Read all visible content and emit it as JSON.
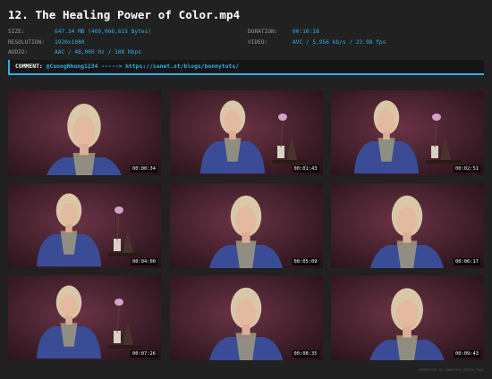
{
  "title": "12. The Healing Power of Color.mp4",
  "meta": {
    "size_label": "SIZE:",
    "size_value": "647.34 MB (469,066,615 Bytes)",
    "duration_label": "DURATION:",
    "duration_value": "00:10:18",
    "resolution_label": "RESOLUTION:",
    "resolution_value": "1920x1080",
    "video_label": "VIDEO:",
    "video_value": "AVC / 5,956 kb/s / 23.98 fps",
    "audio_label": "AUDIO:",
    "audio_value": "AAC / 48,000 Hz / 108 Kbps"
  },
  "comment": {
    "label": "COMMENT:",
    "text": "@CuongNhung1234 -----> https://sanet.st/blogs/bonnytuts/"
  },
  "thumbnails": [
    {
      "timestamp": "00:00:34"
    },
    {
      "timestamp": "00:01:43"
    },
    {
      "timestamp": "00:02:51"
    },
    {
      "timestamp": "00:04:00"
    },
    {
      "timestamp": "00:05:09"
    },
    {
      "timestamp": "00:06:17"
    },
    {
      "timestamp": "00:07:26"
    },
    {
      "timestamp": "00:08:35"
    },
    {
      "timestamp": "00:09:43"
    }
  ],
  "footer": "GENERATED BY ANDROIDS.MEDIA.TOOL",
  "colors": {
    "background": "#212121",
    "accent": "#2fb0e8",
    "thumb_backdrop": "#43202c",
    "sweater": "#3a4c96",
    "hair": "#d8c8a8"
  }
}
